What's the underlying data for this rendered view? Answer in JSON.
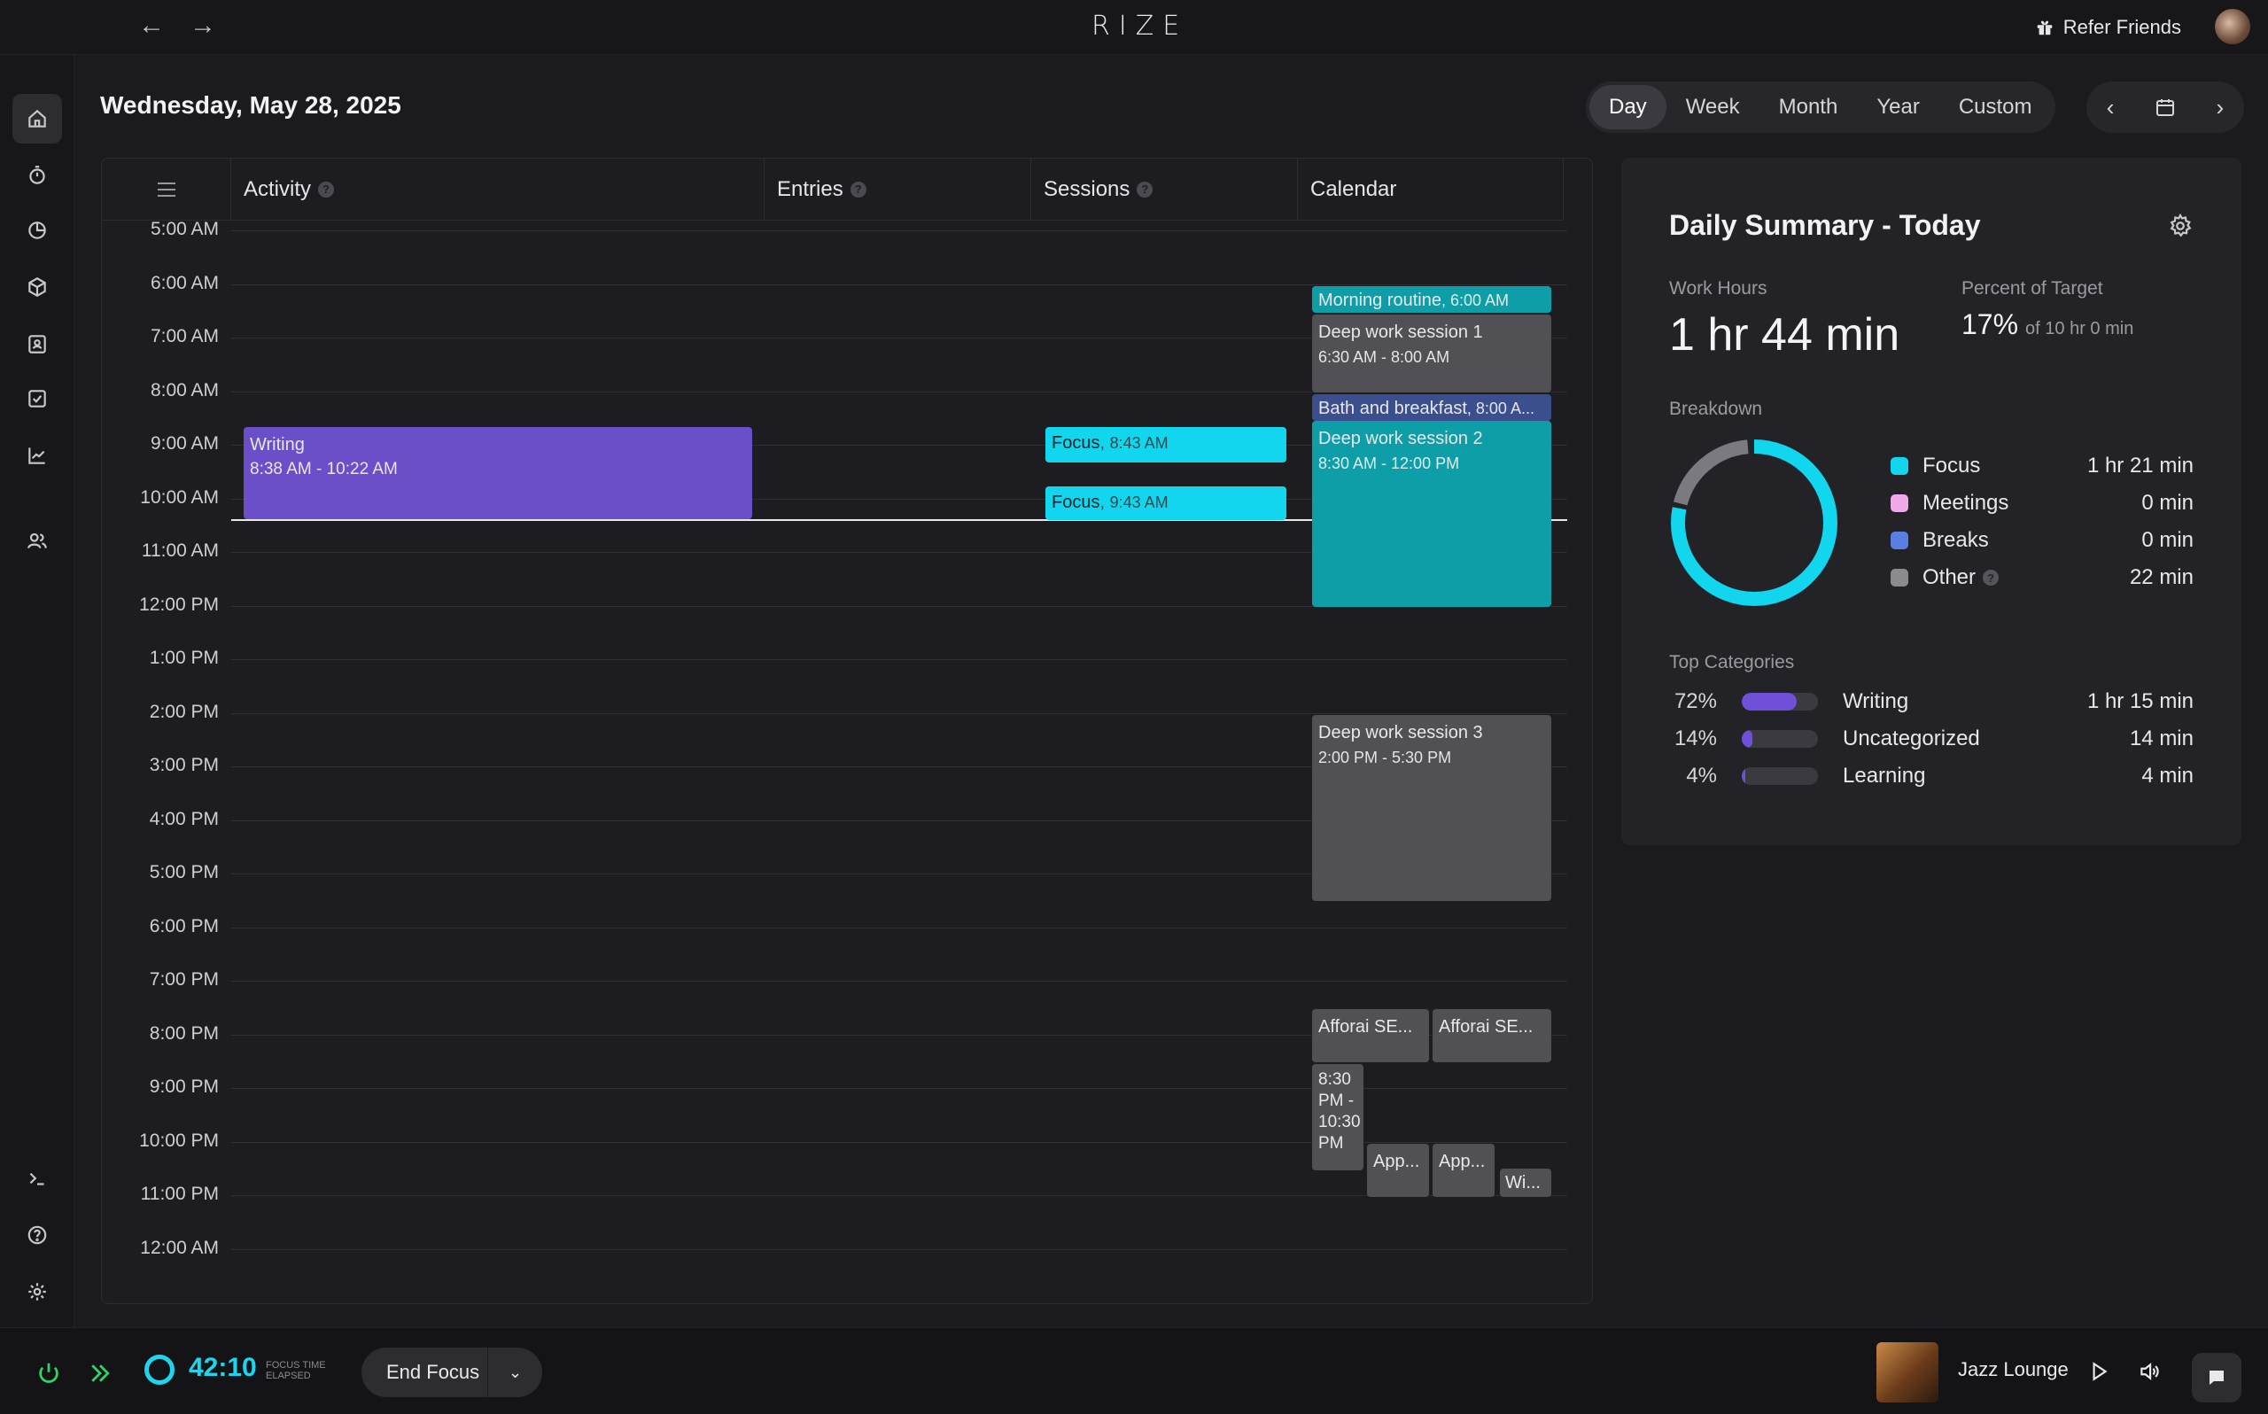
{
  "app": {
    "title": "RIZE",
    "refer_label": "Refer Friends"
  },
  "header": {
    "date": "Wednesday, May 28, 2025",
    "ranges": [
      "Day",
      "Week",
      "Month",
      "Year",
      "Custom"
    ],
    "active_range": "Day"
  },
  "columns": {
    "activity": "Activity",
    "entries": "Entries",
    "sessions": "Sessions",
    "calendar": "Calendar"
  },
  "hours": [
    "5:00 AM",
    "6:00 AM",
    "7:00 AM",
    "8:00 AM",
    "9:00 AM",
    "10:00 AM",
    "11:00 AM",
    "12:00 PM",
    "1:00 PM",
    "2:00 PM",
    "3:00 PM",
    "4:00 PM",
    "5:00 PM",
    "6:00 PM",
    "7:00 PM",
    "8:00 PM",
    "9:00 PM",
    "10:00 PM",
    "11:00 PM",
    "12:00 AM"
  ],
  "activity": {
    "title": "Writing",
    "time": "8:38 AM - 10:22 AM",
    "color": "#6a4fc8"
  },
  "sessions": [
    {
      "title": "Focus",
      "time": "8:43 AM",
      "color": "#12d6ee"
    },
    {
      "title": "Focus",
      "time": "9:43 AM",
      "color": "#12d6ee"
    }
  ],
  "calendar": {
    "morning_routine": {
      "title": "Morning routine",
      "time": "6:00 AM"
    },
    "deep1": {
      "title": "Deep work session 1",
      "time": "6:30 AM - 8:00 AM"
    },
    "bath": {
      "title": "Bath and breakfast",
      "time": "8:00 A..."
    },
    "deep2": {
      "title": "Deep work session 2",
      "time": "8:30 AM - 12:00 PM"
    },
    "deep3": {
      "title": "Deep work session 3",
      "time": "2:00 PM - 5:30 PM"
    },
    "afforai1": {
      "title": "Afforai SE..."
    },
    "afforai2": {
      "title": "Afforai SE..."
    },
    "evening": {
      "time": "8:30 PM - 10:30 PM"
    },
    "app1": {
      "title": "App..."
    },
    "app2": {
      "title": "App..."
    },
    "wi": {
      "title": "Wi..."
    }
  },
  "summary": {
    "title": "Daily Summary - Today",
    "work_hours_label": "Work Hours",
    "work_hours": "1 hr 44 min",
    "percent_label": "Percent of Target",
    "percent": "17%",
    "percent_of": "of 10 hr 0 min",
    "breakdown_label": "Breakdown",
    "breakdown": [
      {
        "name": "Focus",
        "value": "1 hr 21 min",
        "color": "#12d6ee"
      },
      {
        "name": "Meetings",
        "value": "0 min",
        "color": "#f0a8e8"
      },
      {
        "name": "Breaks",
        "value": "0 min",
        "color": "#5b7fe0"
      },
      {
        "name": "Other",
        "value": "22 min",
        "color": "#8a8a8f"
      }
    ],
    "top_categories_label": "Top Categories",
    "categories": [
      {
        "pct": "72%",
        "fraction": 0.72,
        "name": "Writing",
        "duration": "1 hr 15 min"
      },
      {
        "pct": "14%",
        "fraction": 0.14,
        "name": "Uncategorized",
        "duration": "14 min"
      },
      {
        "pct": "4%",
        "fraction": 0.04,
        "name": "Learning",
        "duration": "4 min"
      }
    ],
    "donut": {
      "focus_fraction": 0.78,
      "other_fraction": 0.22
    }
  },
  "footer": {
    "timer": "42:10",
    "timer_caption_1": "FOCUS TIME",
    "timer_caption_2": "ELAPSED",
    "end_focus": "End Focus",
    "track": "Jazz Lounge"
  }
}
